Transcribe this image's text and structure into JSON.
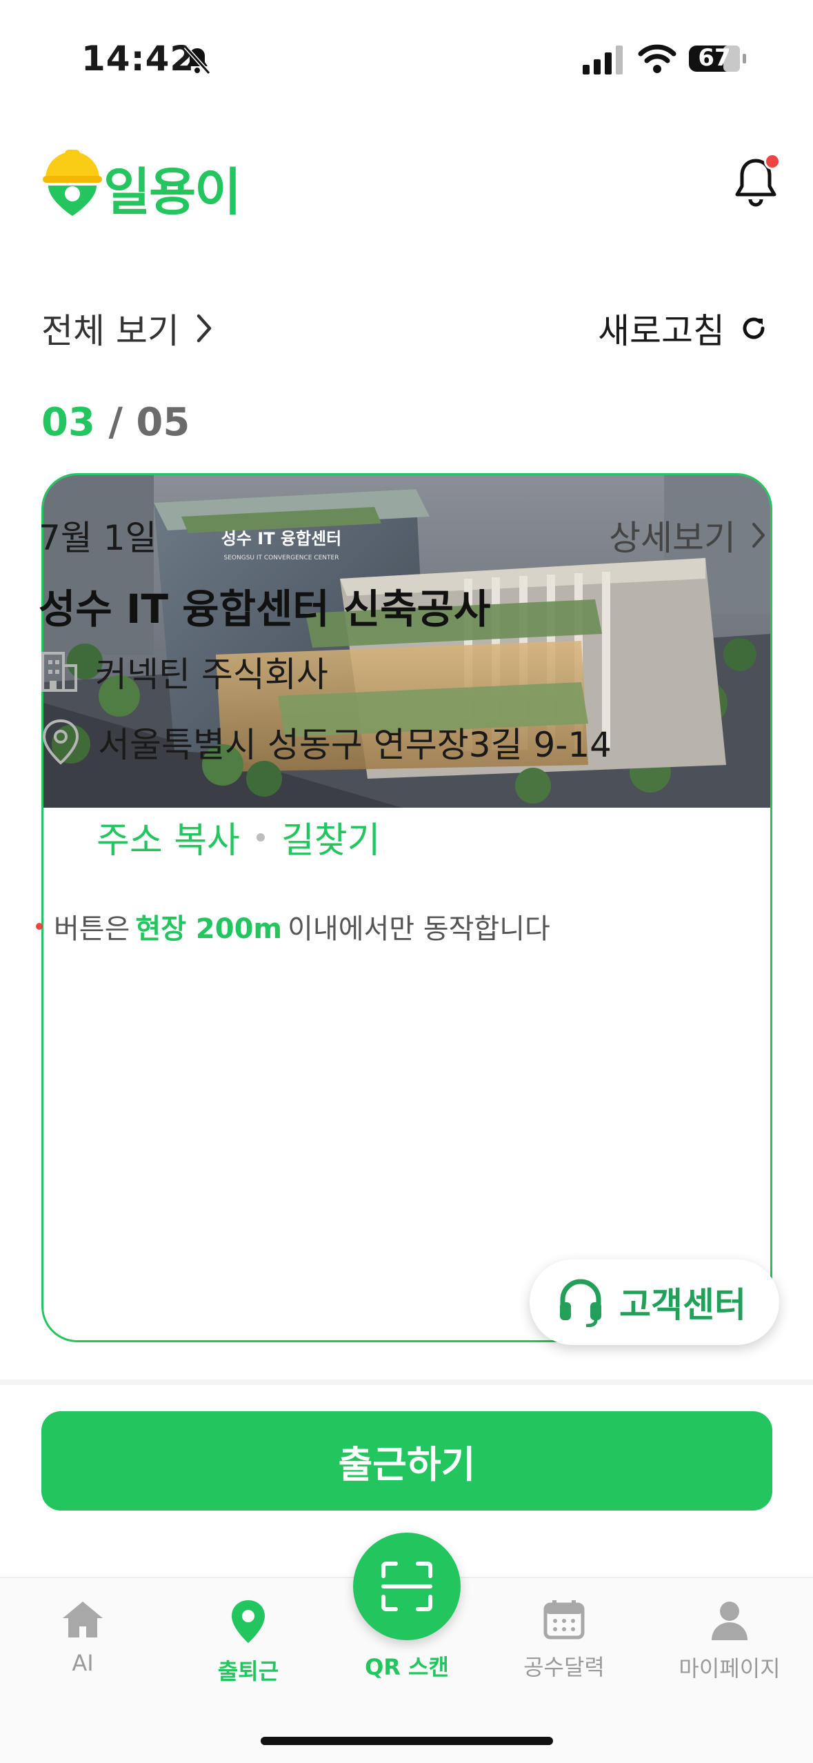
{
  "status_bar": {
    "time": "14:42",
    "battery": "67"
  },
  "header": {
    "app_name": "일용이",
    "notification_dot": true
  },
  "actions": {
    "view_all": "전체 보기",
    "refresh": "새로고침"
  },
  "pager": {
    "current": "03",
    "separator": "/",
    "total": "05"
  },
  "card": {
    "image_sign": "성수 IT 융합센터",
    "image_sign_sub": "SEONGSU IT CONVERGENCE CENTER",
    "date": "7월 1일",
    "detail_label": "상세보기",
    "title": "성수 IT 융합센터 신축공사",
    "company": "커넥틴 주식회사",
    "address": "서울특별시 성동구 연무장3길 9-14",
    "copy_address": "주소 복사",
    "directions": "길찾기",
    "notice_prefix": "버튼은",
    "notice_highlight": "현장 200m",
    "notice_suffix": "이내에서만 동작합니다"
  },
  "floating": {
    "customer_center": "고객센터"
  },
  "checkin_button": "출근하기",
  "tabs": [
    {
      "label": "AI",
      "icon": "home-icon"
    },
    {
      "label": "출퇴근",
      "icon": "location-pin-icon",
      "active": true
    },
    {
      "label": "QR 스캔",
      "icon": "qr-scan-icon"
    },
    {
      "label": "공수달력",
      "icon": "calendar-icon"
    },
    {
      "label": "마이페이지",
      "icon": "person-icon"
    }
  ],
  "colors": {
    "brand": "#22c55e",
    "alert": "#ef4444"
  }
}
